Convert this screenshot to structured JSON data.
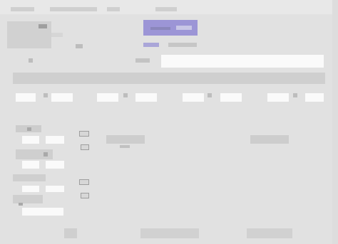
{
  "window": {
    "menu": [
      "",
      "",
      "",
      ""
    ],
    "title": ""
  },
  "header": {
    "left_title": "",
    "left_sub": "",
    "mid_top": "",
    "mid_bottom_left": "",
    "mid_bottom_right": "",
    "accent": "#9c95d6"
  },
  "search": {
    "label": "",
    "placeholder": "",
    "value": ""
  },
  "toolbar": {
    "label": ""
  },
  "filters": [
    {
      "label": "",
      "value": ""
    },
    {
      "label": "",
      "value": ""
    },
    {
      "label": "",
      "value": ""
    },
    {
      "label": "",
      "value": ""
    }
  ],
  "left_panel": {
    "sections": [
      {
        "title": "",
        "field1": "",
        "field2": ""
      },
      {
        "title": "",
        "field1": "",
        "field2": ""
      },
      {
        "title": "",
        "field1": "",
        "field2": ""
      },
      {
        "title": "",
        "field1": "",
        "field2": ""
      }
    ]
  },
  "content": {
    "card_left": {
      "title": "",
      "sub": ""
    },
    "card_right": {
      "title": ""
    }
  },
  "footer": {
    "left_btn": "",
    "center_btn": "",
    "right_btn": ""
  }
}
